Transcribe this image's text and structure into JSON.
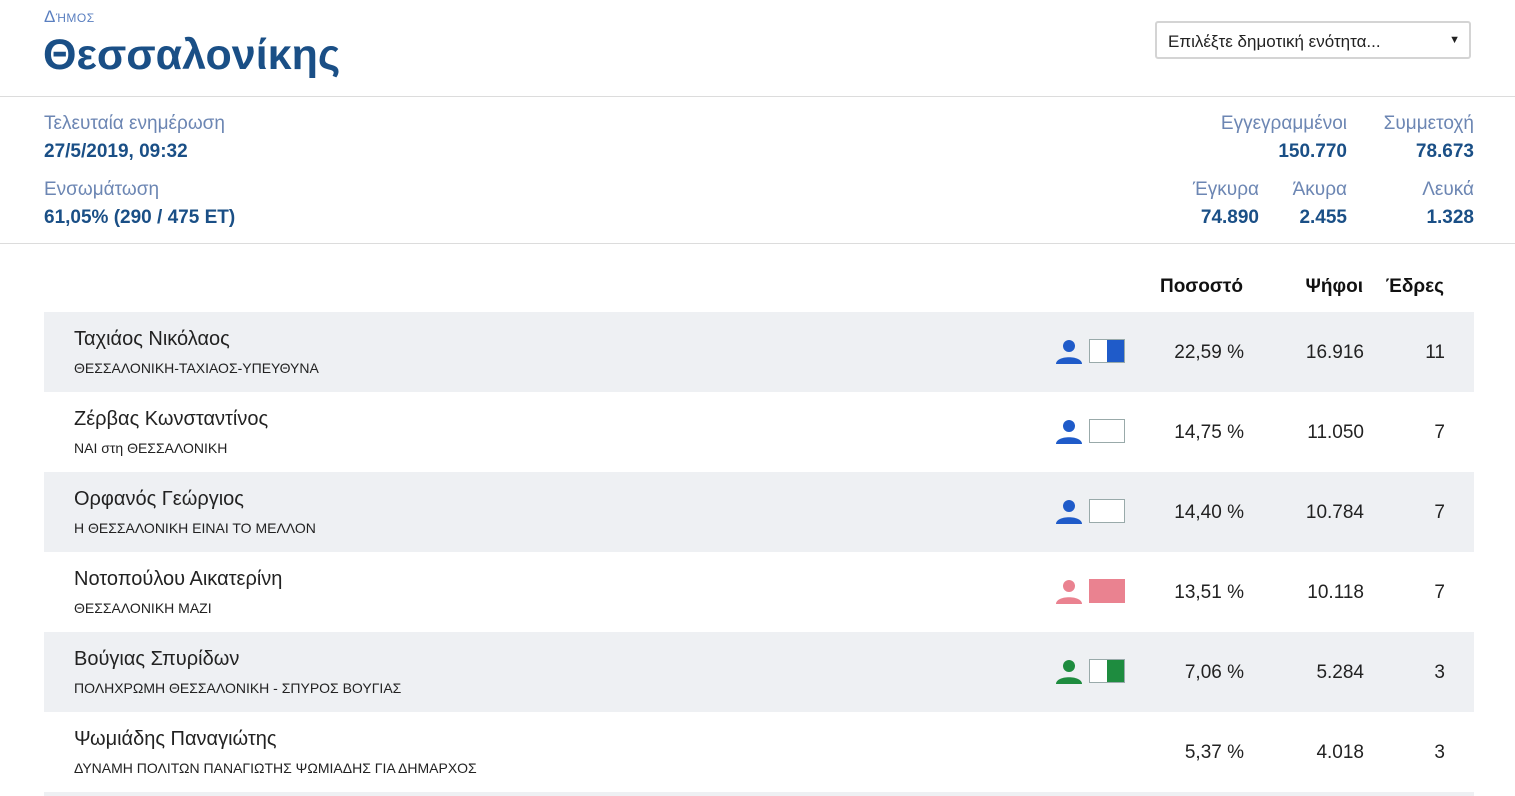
{
  "header": {
    "municipality_label": "Δήμος",
    "municipality_name": "Θεσσαλονίκης",
    "unit_select": {
      "value": "Επιλέξτε δημοτική ενότητα...",
      "arrow": "▼"
    }
  },
  "stats": {
    "last_update_label": "Τελευταία ενημέρωση",
    "last_update_value": "27/5/2019, 09:32",
    "incorporation_label": "Ενσωμάτωση",
    "incorporation_value": "61,05% (290 / 475 ΕΤ)",
    "registered_label": "Εγγεγραμμένοι",
    "registered_value": "150.770",
    "turnout_label": "Συμμετοχή",
    "turnout_value": "78.673",
    "valid_label": "Έγκυρα",
    "valid_value": "74.890",
    "invalid_label": "Άκυρα",
    "invalid_value": "2.455",
    "blank_label": "Λευκά",
    "blank_value": "1.328"
  },
  "table": {
    "columns": {
      "percent": "Ποσοστό",
      "votes": "Ψήφοι",
      "seats": "Έδρες"
    },
    "rows": [
      {
        "name": "Ταχιάος Νικόλαος",
        "party": "ΘΕΣΣΑΛΟΝΙΚΗ-ΤΑΧΙΑΟΣ-ΥΠΕΥΘΥΝΑ",
        "percent": "22,59 %",
        "votes": "16.916",
        "seats": "11",
        "color": "#1f5bc9",
        "icon": "person-icon",
        "fill_fraction": 0.5
      },
      {
        "name": "Ζέρβας Κωνσταντίνος",
        "party": "ΝΑΙ στη ΘΕΣΣΑΛΟΝΙΚΗ",
        "percent": "14,75 %",
        "votes": "11.050",
        "seats": "7",
        "color": "#1f5bc9",
        "icon": "person-icon",
        "fill_fraction": 0
      },
      {
        "name": "Ορφανός Γεώργιος",
        "party": "Η ΘΕΣΣΑΛΟΝΙΚΗ ΕΙΝΑΙ ΤΟ ΜΕΛΛΟΝ",
        "percent": "14,40 %",
        "votes": "10.784",
        "seats": "7",
        "color": "#1f5bc9",
        "icon": "person-icon",
        "fill_fraction": 0
      },
      {
        "name": "Νοτοπούλου Αικατερίνη",
        "party": "ΘΕΣΣΑΛΟΝΙΚΗ ΜΑΖΙ",
        "percent": "13,51 %",
        "votes": "10.118",
        "seats": "7",
        "color": "#ea8290",
        "icon": "person-icon",
        "fill_fraction": 1
      },
      {
        "name": "Βούγιας Σπυρίδων",
        "party": "ΠΟΛΗΧΡΩΜΗ ΘΕΣΣΑΛΟΝΙΚΗ - ΣΠΥΡΟΣ ΒΟΥΓΙΑΣ",
        "percent": "7,06 %",
        "votes": "5.284",
        "seats": "3",
        "color": "#1e8c3f",
        "icon": "person-icon",
        "fill_fraction": 0.5
      },
      {
        "name": "Ψωμιάδης Παναγιώτης",
        "party": "ΔΥΝΑΜΗ ΠΟΛΙΤΩΝ ΠΑΝΑΓΙΩΤΗΣ ΨΩΜΙΑΔΗΣ ΓΙΑ ΔΗΜΑΡΧΟΣ",
        "percent": "5,37 %",
        "votes": "4.018",
        "seats": "3",
        "color": "",
        "icon": "",
        "fill_fraction": null
      }
    ]
  }
}
